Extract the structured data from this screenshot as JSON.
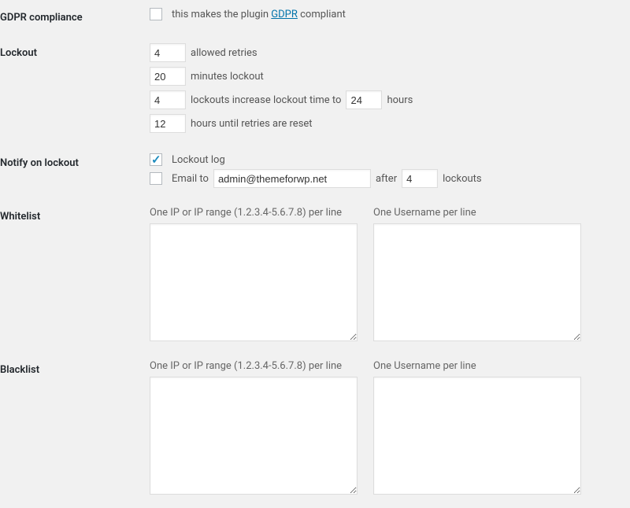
{
  "gdpr": {
    "row_label": "GDPR compliance",
    "checked": false,
    "text_before": "this makes the plugin ",
    "link_text": "GDPR",
    "text_after": " compliant"
  },
  "lockout": {
    "row_label": "Lockout",
    "retries_value": "4",
    "retries_label": "allowed retries",
    "minutes_value": "20",
    "minutes_label": "minutes lockout",
    "increase_count_value": "4",
    "increase_label_before": "lockouts increase lockout time to",
    "increase_hours_value": "24",
    "increase_label_after": "hours",
    "reset_value": "12",
    "reset_label": "hours until retries are reset"
  },
  "notify": {
    "row_label": "Notify on lockout",
    "log_checked": true,
    "log_label": "Lockout log",
    "email_checked": false,
    "email_label": "Email to",
    "email_value": "admin@themeforwp.net",
    "after_label": "after",
    "after_value": "4",
    "lockouts_label": "lockouts"
  },
  "whitelist": {
    "row_label": "Whitelist",
    "ip_label": "One IP or IP range (1.2.3.4-5.6.7.8) per line",
    "user_label": "One Username per line",
    "ip_value": "",
    "user_value": ""
  },
  "blacklist": {
    "row_label": "Blacklist",
    "ip_label": "One IP or IP range (1.2.3.4-5.6.7.8) per line",
    "user_label": "One Username per line",
    "ip_value": "",
    "user_value": ""
  }
}
